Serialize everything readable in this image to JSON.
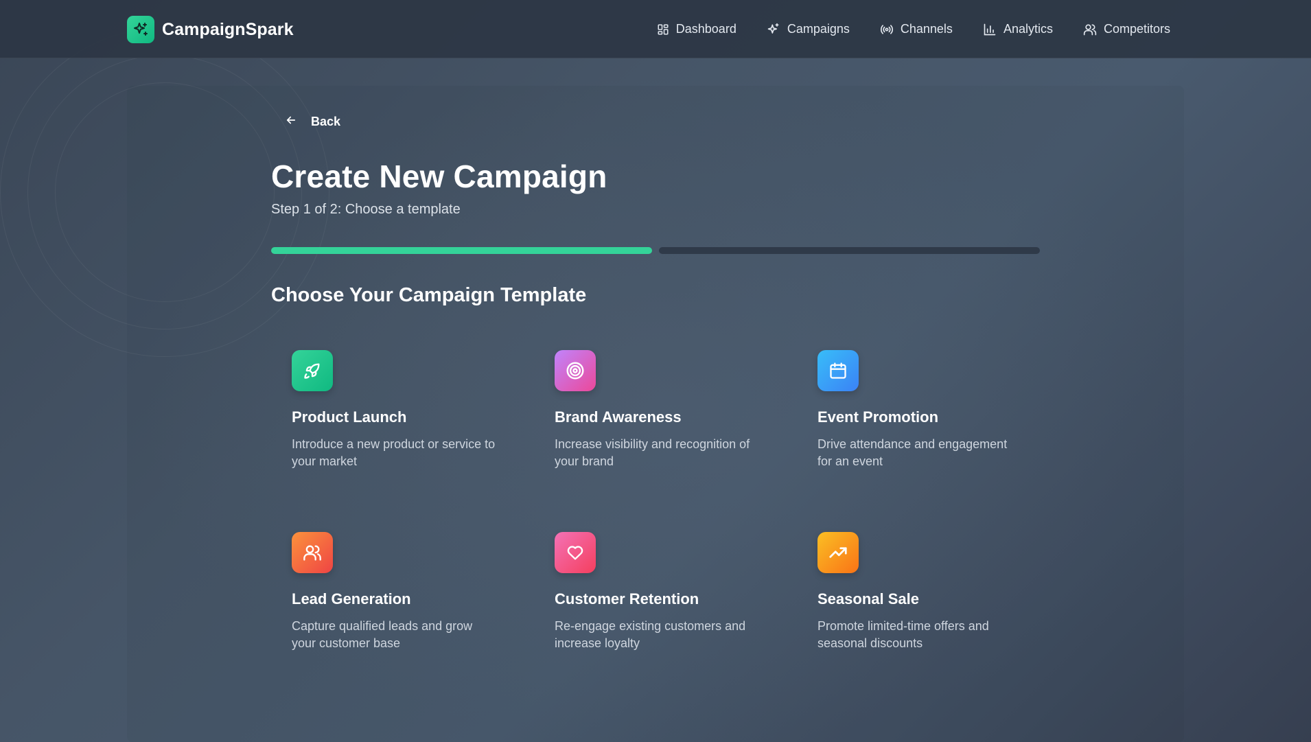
{
  "app": {
    "name": "CampaignSpark",
    "logo_icon": "sparkles-icon"
  },
  "nav": {
    "items": [
      {
        "label": "Dashboard",
        "icon": "grid-icon"
      },
      {
        "label": "Campaigns",
        "icon": "sparkles-icon"
      },
      {
        "label": "Channels",
        "icon": "broadcast-icon"
      },
      {
        "label": "Analytics",
        "icon": "bar-chart-icon"
      },
      {
        "label": "Competitors",
        "icon": "users-icon"
      }
    ]
  },
  "back": {
    "label": "Back",
    "icon": "arrow-left-icon"
  },
  "page": {
    "title": "Create New Campaign",
    "step": "Step 1 of 2: Choose a template",
    "progress": {
      "current_step": 1,
      "total_steps": 2
    }
  },
  "section": {
    "title": "Choose Your Campaign Template"
  },
  "templates": [
    {
      "title": "Product Launch",
      "description": "Introduce a new product or service to your market",
      "icon": "rocket-icon",
      "colors": [
        "#34d399",
        "#10b981"
      ]
    },
    {
      "title": "Brand Awareness",
      "description": "Increase visibility and recognition of your brand",
      "icon": "target-icon",
      "colors": [
        "#c084fc",
        "#ec4899"
      ]
    },
    {
      "title": "Event Promotion",
      "description": "Drive attendance and engagement for an event",
      "icon": "calendar-icon",
      "colors": [
        "#38bdf8",
        "#3b82f6"
      ]
    },
    {
      "title": "Lead Generation",
      "description": "Capture qualified leads and grow your customer base",
      "icon": "users-icon",
      "colors": [
        "#fb923c",
        "#ef4444"
      ]
    },
    {
      "title": "Customer Retention",
      "description": "Re-engage existing customers and increase loyalty",
      "icon": "heart-icon",
      "colors": [
        "#f472b6",
        "#f43f5e"
      ]
    },
    {
      "title": "Seasonal Sale",
      "description": "Promote limited-time offers and seasonal discounts",
      "icon": "trending-up-icon",
      "colors": [
        "#fbbf24",
        "#f97316"
      ]
    }
  ],
  "colors": {
    "accent": "#34d399",
    "progress_inactive": "#2f3a49",
    "nav_background": "#2c3644"
  }
}
